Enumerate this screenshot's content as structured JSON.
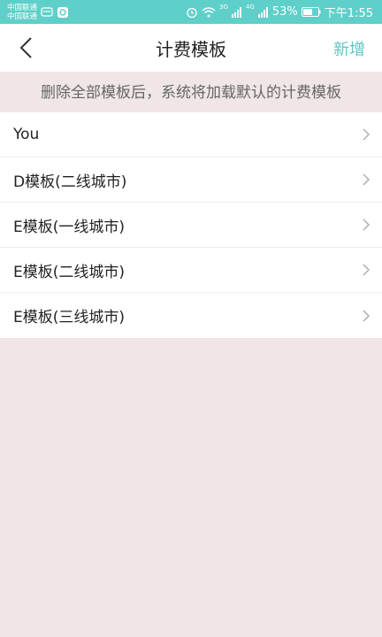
{
  "status_bar": {
    "carrier_1": "中国联通",
    "carrier_2": "中国联通",
    "network_1": "3G",
    "network_2": "4G",
    "battery": "53%",
    "time": "下午1:55"
  },
  "header": {
    "title": "计费模板",
    "add_label": "新增"
  },
  "notice": "删除全部模板后，系统将加载默认的计费模板",
  "templates": [
    {
      "label": "You"
    },
    {
      "label": "D模板(二线城市)"
    },
    {
      "label": "E模板(一线城市)"
    },
    {
      "label": "E模板(二线城市)"
    },
    {
      "label": "E模板(三线城市)"
    }
  ],
  "colors": {
    "status_bar": "#5fcfc9",
    "accent": "#5fc6c0",
    "background": "#f0e6e7"
  }
}
